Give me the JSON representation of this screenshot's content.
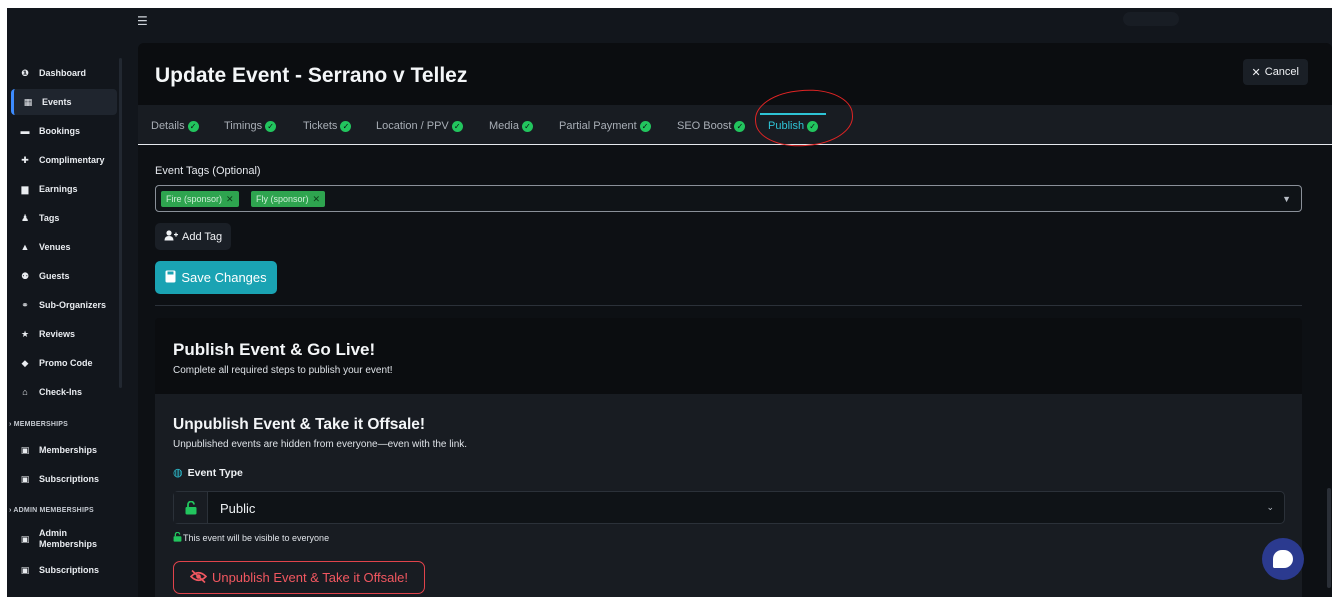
{
  "topbar": {
    "menu_icon": "hamburger-icon"
  },
  "sidebar": {
    "items": [
      {
        "label": "Dashboard",
        "icon": "info-icon",
        "glyph": "❶"
      },
      {
        "label": "Events",
        "icon": "calendar-icon",
        "glyph": "▦",
        "active": true
      },
      {
        "label": "Bookings",
        "icon": "ticket-icon",
        "glyph": "▬"
      },
      {
        "label": "Complimentary",
        "icon": "puzzle-icon",
        "glyph": "✚"
      },
      {
        "label": "Earnings",
        "icon": "wallet-icon",
        "glyph": "▆"
      },
      {
        "label": "Tags",
        "icon": "user-tag-icon",
        "glyph": "♟"
      },
      {
        "label": "Venues",
        "icon": "venue-icon",
        "glyph": "▲"
      },
      {
        "label": "Guests",
        "icon": "guests-icon",
        "glyph": "⚉"
      },
      {
        "label": "Sub-Organizers",
        "icon": "sub-organizers-icon",
        "glyph": "⚭"
      },
      {
        "label": "Reviews",
        "icon": "star-icon",
        "glyph": "★"
      },
      {
        "label": "Promo Code",
        "icon": "tag-icon",
        "glyph": "◆"
      },
      {
        "label": "Check-Ins",
        "icon": "building-icon",
        "glyph": "⌂"
      }
    ],
    "memberships_section": "MEMBERSHIPS",
    "memberships_items": [
      {
        "label": "Memberships",
        "icon": "id-card-icon",
        "glyph": "▣"
      },
      {
        "label": "Subscriptions",
        "icon": "id-card-icon",
        "glyph": "▣"
      }
    ],
    "admin_section": "ADMIN MEMBERSHIPS",
    "admin_items": [
      {
        "label": "Admin Memberships",
        "line1": "Admin",
        "line2": "Memberships",
        "icon": "id-card-icon",
        "glyph": "▣"
      },
      {
        "label": "Subscriptions",
        "icon": "id-card-icon",
        "glyph": "▣"
      }
    ]
  },
  "header": {
    "title": "Update Event - Serrano v Tellez",
    "cancel_label": "Cancel"
  },
  "tabs": [
    {
      "label": "Details",
      "complete": true
    },
    {
      "label": "Timings",
      "complete": true
    },
    {
      "label": "Tickets",
      "complete": true
    },
    {
      "label": "Location / PPV",
      "complete": true
    },
    {
      "label": "Media",
      "complete": true
    },
    {
      "label": "Partial Payment",
      "complete": true
    },
    {
      "label": "SEO Boost",
      "complete": true
    },
    {
      "label": "Publish",
      "complete": true,
      "active": true
    }
  ],
  "tags_field": {
    "label": "Event Tags (Optional)",
    "chips": [
      "Fire (sponsor)",
      "Fly (sponsor)"
    ],
    "add_tag_label": "Add Tag"
  },
  "save_label": "Save Changes",
  "publish": {
    "title": "Publish Event & Go Live!",
    "subtitle": "Complete all required steps to publish your event!"
  },
  "unpublish": {
    "title": "Unpublish Event & Take it Offsale!",
    "subtitle": "Unpublished events are hidden from everyone—even with the link.",
    "event_type_label": "Event Type",
    "event_type_value": "Public",
    "visibility_note": "This event will be visible to everyone",
    "button_label": "Unpublish Event & Take it Offsale!"
  },
  "colors": {
    "accent": "#2ec4d6",
    "success": "#22c55e",
    "danger": "#e0434b",
    "annotation": "#e02424"
  }
}
